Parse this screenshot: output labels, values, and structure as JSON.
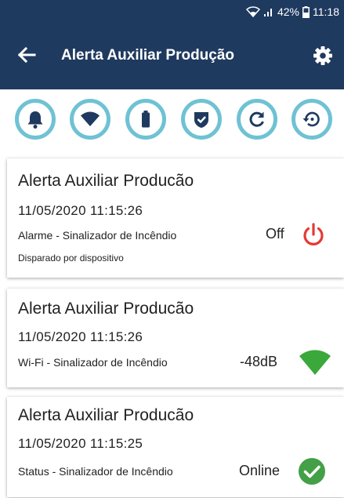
{
  "status_bar": {
    "battery": "42%",
    "time": "11:18"
  },
  "header": {
    "title": "Alerta Auxiliar Produção"
  },
  "icon_row": [
    {
      "icon": "bell-icon"
    },
    {
      "icon": "wifi-icon"
    },
    {
      "icon": "battery-icon"
    },
    {
      "icon": "shield-check-icon"
    },
    {
      "icon": "refresh-icon"
    },
    {
      "icon": "history-icon"
    }
  ],
  "colors": {
    "header_bg": "#1f3a5f",
    "icon_ring": "#6fc2d4",
    "icon_fill": "#1f3a5f",
    "power_red": "#e53935",
    "signal_green": "#3aa83a",
    "check_green": "#43a047"
  },
  "cards": [
    {
      "title": "Alerta Auxiliar Producão",
      "datetime": "11/05/2020  11:15:26",
      "description": "Alarme - Sinalizador de Incêndio",
      "subtext": "Disparado por dispositivo",
      "value": "Off",
      "icon": "power-icon"
    },
    {
      "title": "Alerta Auxiliar Producão",
      "datetime": "11/05/2020  11:15:26",
      "description": "Wi-Fi - Sinalizador de Incêndio",
      "value": "-48dB",
      "icon": "wifi-signal-icon"
    },
    {
      "title": "Alerta Auxiliar Producão",
      "datetime": "11/05/2020  11:15:25",
      "description": "Status - Sinalizador de Incêndio",
      "value": "Online",
      "icon": "check-circle-icon"
    }
  ]
}
